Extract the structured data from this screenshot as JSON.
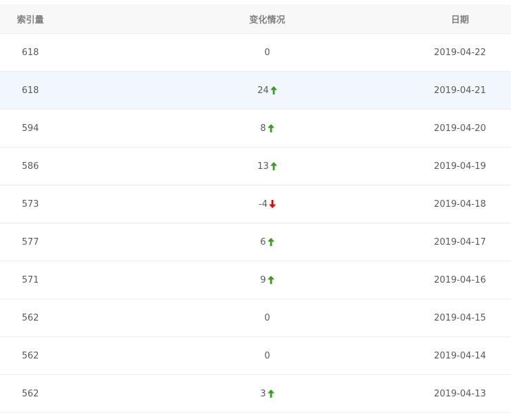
{
  "table": {
    "headers": {
      "index": "索引量",
      "change": "变化情况",
      "date": "日期"
    },
    "rows": [
      {
        "index": "618",
        "change": "0",
        "trend": "none",
        "date": "2019-04-22"
      },
      {
        "index": "618",
        "change": "24",
        "trend": "up",
        "date": "2019-04-21"
      },
      {
        "index": "594",
        "change": "8",
        "trend": "up",
        "date": "2019-04-20"
      },
      {
        "index": "586",
        "change": "13",
        "trend": "up",
        "date": "2019-04-19"
      },
      {
        "index": "573",
        "change": "-4",
        "trend": "down",
        "date": "2019-04-18"
      },
      {
        "index": "577",
        "change": "6",
        "trend": "up",
        "date": "2019-04-17"
      },
      {
        "index": "571",
        "change": "9",
        "trend": "up",
        "date": "2019-04-16"
      },
      {
        "index": "562",
        "change": "0",
        "trend": "none",
        "date": "2019-04-15"
      },
      {
        "index": "562",
        "change": "0",
        "trend": "none",
        "date": "2019-04-14"
      },
      {
        "index": "562",
        "change": "3",
        "trend": "up",
        "date": "2019-04-13"
      }
    ],
    "highlighted_row": 1
  },
  "colors": {
    "up": "#3a9a22",
    "down": "#e60000",
    "highlight": "#f2f6fd"
  },
  "icons": {
    "up": "arrow-up-icon",
    "down": "arrow-down-icon"
  }
}
